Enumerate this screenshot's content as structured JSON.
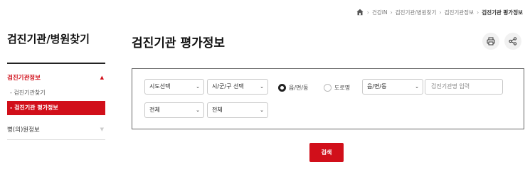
{
  "breadcrumb": {
    "items": [
      "건강iN",
      "검진기관/병원찾기",
      "검진기관정보"
    ],
    "current": "검진기관 평가정보"
  },
  "sidebar": {
    "title": "검진기관/병원찾기",
    "menu1": "검진기관정보",
    "sub1": "- 검진기관찾기",
    "sub_active": "- 검진기관 평가정보",
    "menu2": "병(의)원정보"
  },
  "main": {
    "title": "검진기관 평가정보"
  },
  "search": {
    "sido": "시도선택",
    "sigungu": "시/군/구 선택",
    "radio_emd": "읍/면/동",
    "radio_road": "도로명",
    "emd_select": "읍/면/동",
    "name_placeholder": "검진기관명 입력",
    "filter1": "전체",
    "filter2": "전체",
    "button": "검색"
  },
  "colors": {
    "accent": "#d10f1a"
  }
}
